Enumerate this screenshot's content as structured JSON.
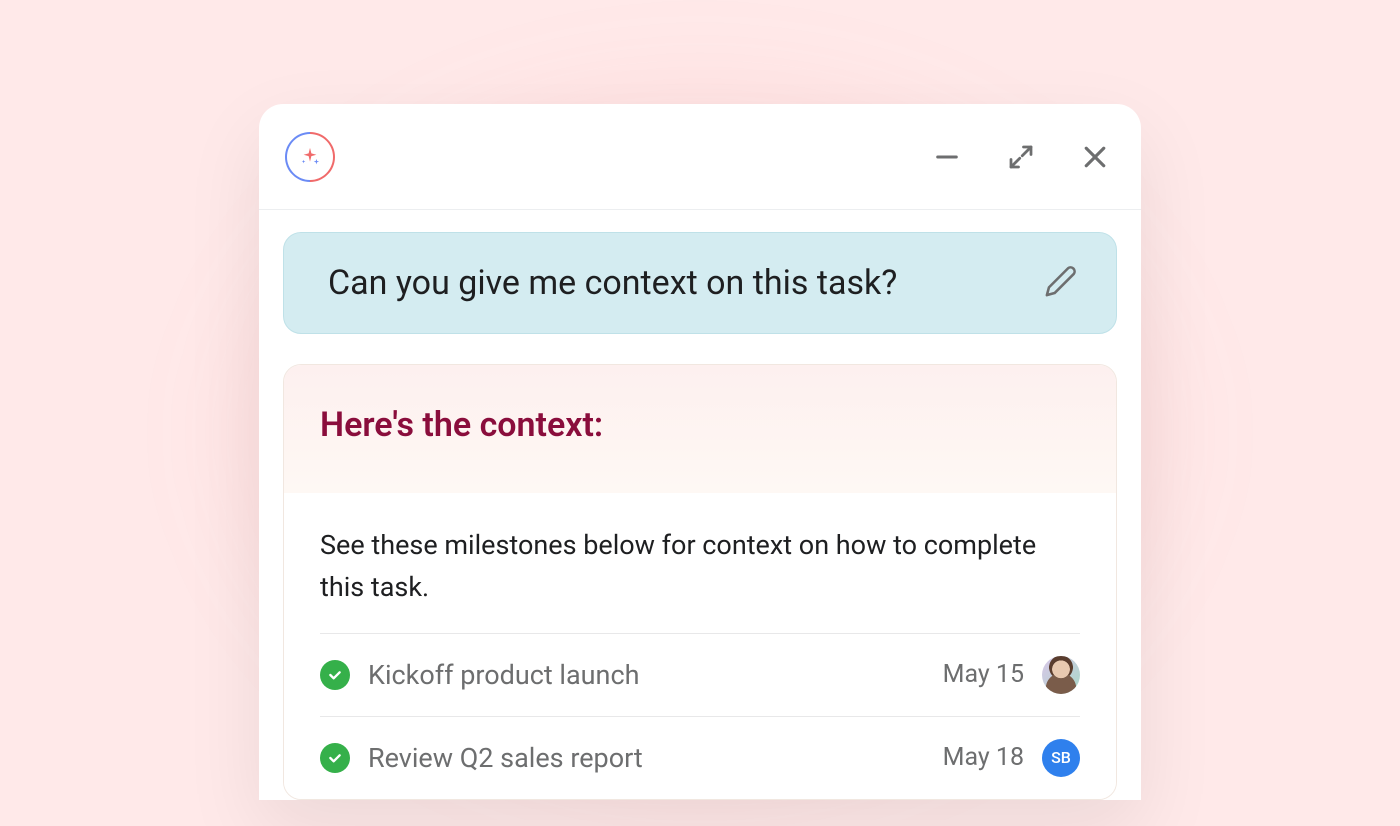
{
  "query": {
    "text": "Can you give me context on this task?"
  },
  "response": {
    "title": "Here's the context:",
    "description": "See these milestones below for context on how to complete this task."
  },
  "milestones": [
    {
      "title": "Kickoff product launch",
      "date": "May 15",
      "avatar_type": "photo",
      "avatar_initials": ""
    },
    {
      "title": "Review Q2 sales report",
      "date": "May 18",
      "avatar_type": "initials",
      "avatar_initials": "SB"
    }
  ]
}
